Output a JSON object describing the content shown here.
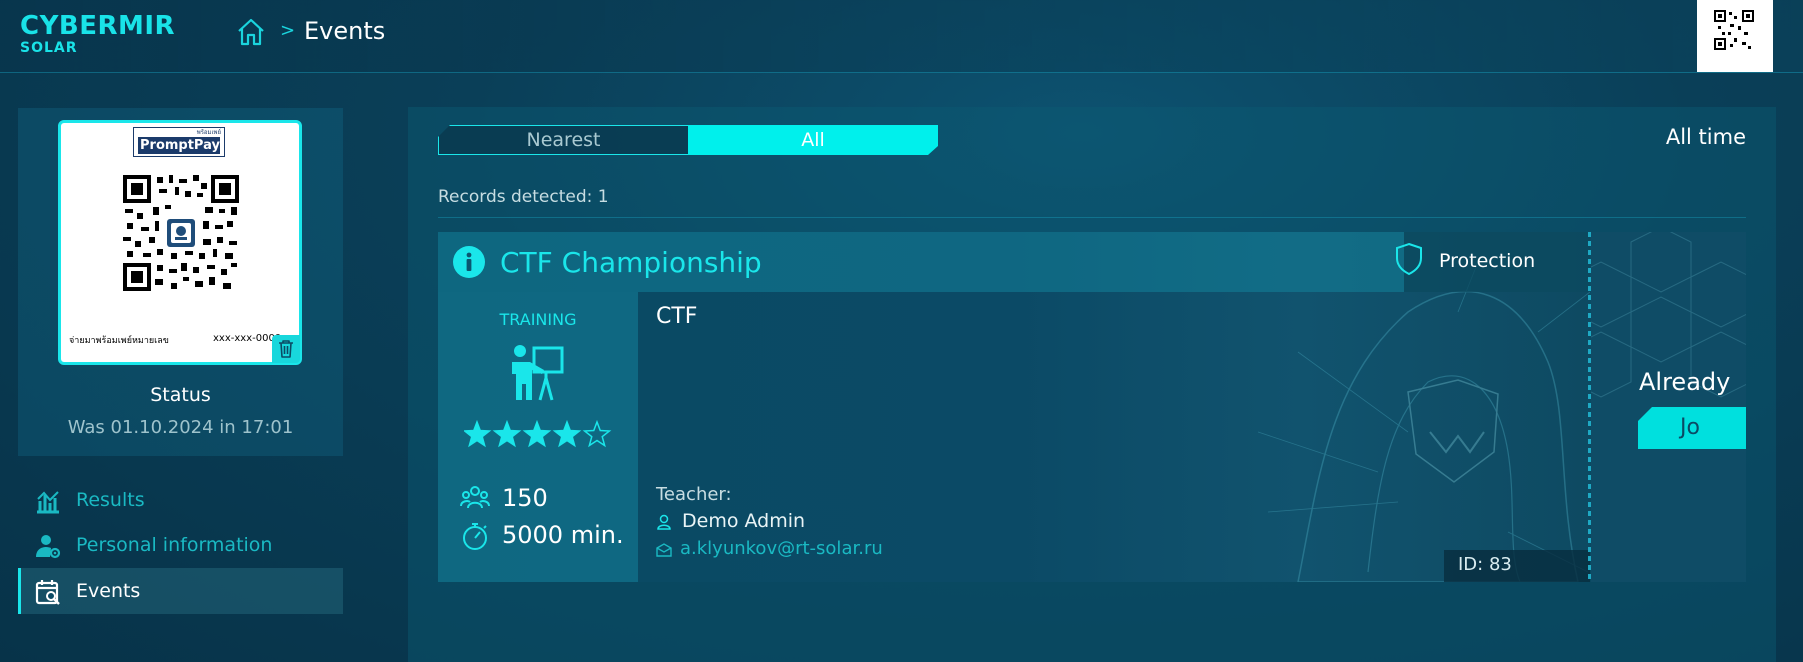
{
  "header": {
    "logo_line1": "CYBERMIR",
    "logo_line2": "SOLAR",
    "breadcrumb_separator": ">",
    "breadcrumb_current": "Events"
  },
  "profile": {
    "promptpay_small": "พร้อมเพย์",
    "promptpay_brand": "PromptPay",
    "qr_caption": "จ่ายมาพร้อมเพย์หมายเลข",
    "qr_number": "xxx-xxx-0000",
    "status_title": "Status",
    "status_value": "Was 01.10.2024 in 17:01"
  },
  "nav": {
    "items": [
      {
        "label": "Results",
        "icon": "chart-icon",
        "active": false
      },
      {
        "label": "Personal information",
        "icon": "user-settings-icon",
        "active": false
      },
      {
        "label": "Events",
        "icon": "calendar-search-icon",
        "active": true
      }
    ]
  },
  "filters": {
    "tabs": [
      {
        "label": "Nearest",
        "selected": false
      },
      {
        "label": "All",
        "selected": true
      }
    ],
    "period": "All time"
  },
  "records_text": "Records detected: 1",
  "event": {
    "title": "CTF Championship",
    "category": "Protection",
    "format": "TRAINING",
    "rating": 4,
    "rating_max": 5,
    "participants": "150",
    "duration": "5000 min.",
    "type": "CTF",
    "teacher_label": "Teacher:",
    "teacher_name": "Demo Admin",
    "teacher_email": "a.klyunkov@rt-solar.ru",
    "id_text": "ID: 83",
    "side_text": "Already",
    "side_button": "Jo"
  },
  "colors": {
    "accent": "#1ae6ea",
    "tab_selected": "#00f0ec",
    "background": "#0a3f58"
  }
}
